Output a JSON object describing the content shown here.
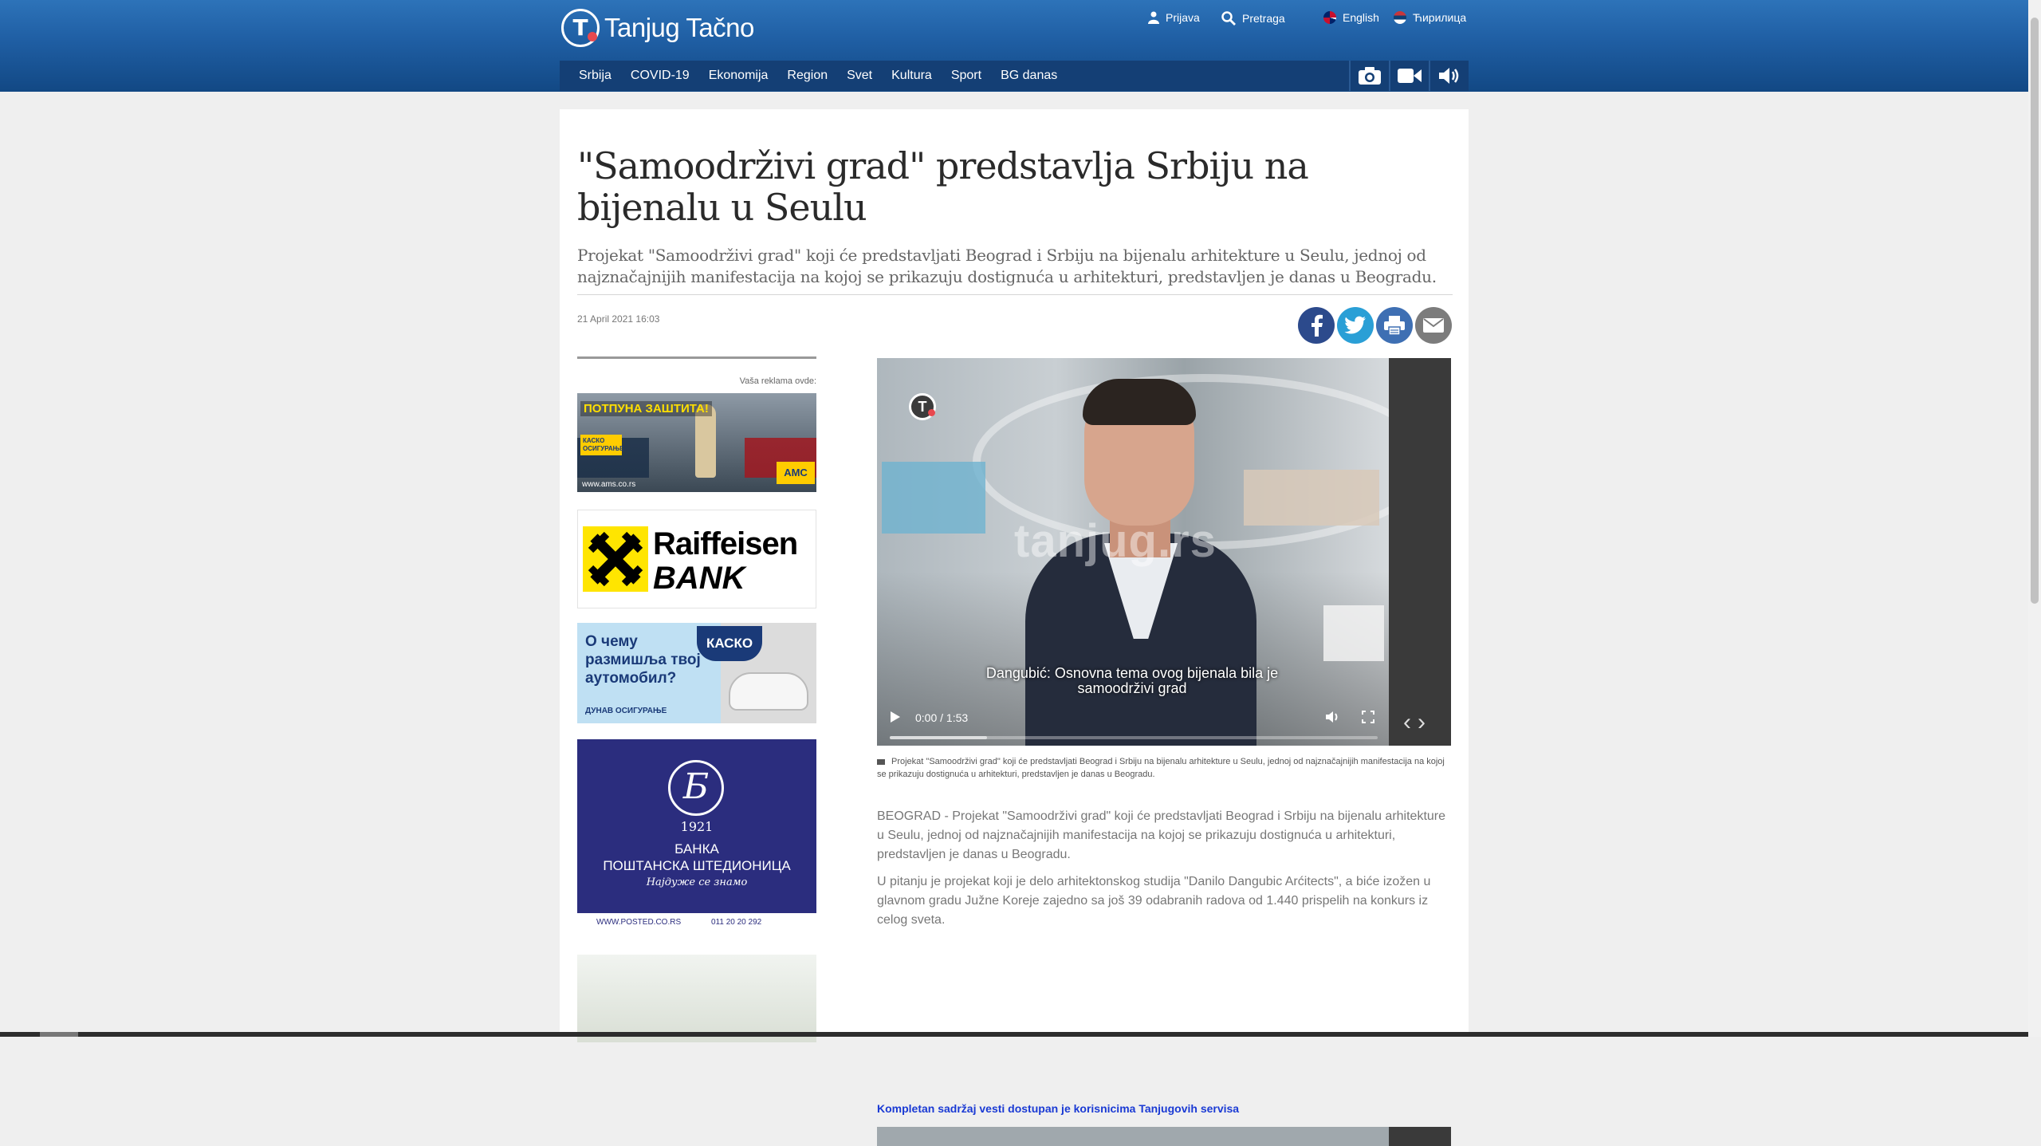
{
  "site": {
    "brand": "Tanjug Tačno",
    "logo_letter": "T"
  },
  "utility_links": {
    "login": "Prijava",
    "search": "Pretraga",
    "english": "English",
    "cyrillic": "Ћирилица"
  },
  "nav": {
    "items": [
      "Srbija",
      "COVID-19",
      "Ekonomija",
      "Region",
      "Svet",
      "Kultura",
      "Sport",
      "BG danas"
    ],
    "icons": [
      "camera-icon",
      "video-icon",
      "audio-icon"
    ]
  },
  "article": {
    "title": "\"Samoodrživi grad\" predstavlja Srbiju na bijenalu u Seulu",
    "lead": "Projekat \"Samoodrživi grad\" koji će predstavljati Beograd i Srbiju na bijenalu arhitekture u Seulu, jednoj od najznačajnijih manifestacija na kojoj se prikazuju dostignuća u arhitekturi, predstavljen je danas u Beogradu.",
    "date": "21 April 2021 16:03",
    "share_icons": [
      "facebook-icon",
      "twitter-icon",
      "print-icon",
      "email-icon"
    ],
    "video": {
      "watermark": "tanjug.rs",
      "logo_letter": "T",
      "subtitle": "Dangubić: Osnovna tema ovog bijenala bila je samoodrživi grad",
      "time": "0:00 / 1:53",
      "buffered_fraction": 0.2,
      "caption": "Projekat \"Samoodrživi grad\" koji će predstavljati Beograd i Srbiju na bijenalu arhitekture u Seulu, jednoj od najznačajnijih manifestacija na kojoj se prikazuju dostignuća u arhitekturi, predstavljen je danas u Beogradu."
    },
    "paragraphs": [
      "BEOGRAD - Projekat \"Samoodrživi grad\" koji će predstavljati Beograd i Srbiju na bijenalu arhitekture u Seulu, jednoj od najznačajnijih manifestacija na kojoj se prikazuju dostignuća u arhitekturi, predstavljen je danas u Beogradu.",
      "U pitanju je projekat koji je delo arhitektonskog studija \"Danilo Dangubic Arćitects\", a biće izožen u glavnom gradu Južne Koreje zajedno sa još 39 odabranih radova od 1.440 prispelih na konkurs iz celog sveta."
    ],
    "notice": "Kompletan sadržaj vesti dostupan je korisnicima Tanjugovih servisa"
  },
  "ads": {
    "caption": "Vaša reklama ovde:",
    "ams": {
      "headline": "ПОТПУНА ЗАШТИТА!",
      "side": "КАСКО ОСИГУРАЊЕ",
      "badge": "АМС",
      "url": "www.ams.co.rs"
    },
    "raiffeisen": {
      "line1": "Raiffeisen",
      "line2": "BANK"
    },
    "dunav": {
      "text": "О чему размишља твој аутомобил?",
      "badge": "КАСКО",
      "footer": "ДУНАВ ОСИГУРАЊЕ"
    },
    "postanska": {
      "year": "1921",
      "line1": "БАНКА",
      "line2": "ПОШТАНСКА ШТЕДИОНИЦА",
      "slogan": "Најдуже се знамо",
      "url": "WWW.POSTED.CO.RS",
      "phone": "011 20 20 292"
    }
  },
  "colors": {
    "header_top": "#2d73b9",
    "header_bottom": "#124884",
    "nav_bg": "#143f75",
    "notice_link": "#1a3ad4"
  }
}
